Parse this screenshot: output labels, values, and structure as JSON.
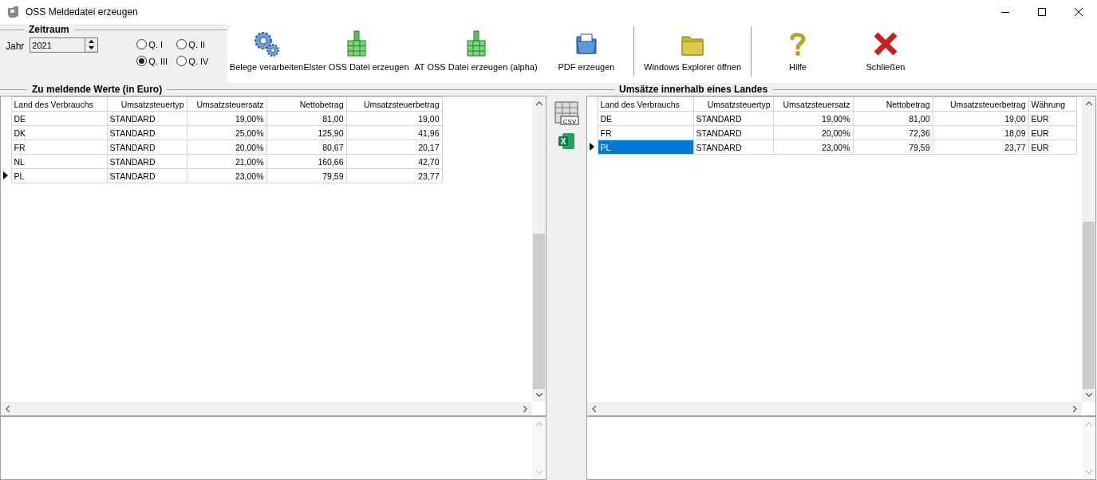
{
  "window": {
    "title": "OSS Meldedatei erzeugen"
  },
  "period": {
    "legend": "Zeitraum",
    "year_label": "Jahr",
    "year": "2021",
    "quarters": [
      {
        "label": "Q. I",
        "selected": false
      },
      {
        "label": "Q. II",
        "selected": false
      },
      {
        "label": "Q. III",
        "selected": true
      },
      {
        "label": "Q. IV",
        "selected": false
      }
    ]
  },
  "toolbar": [
    {
      "kind": "gears",
      "label": "Belege verarbeiten"
    },
    {
      "kind": "package",
      "label": "Elster OSS Datei erzeugen"
    },
    {
      "kind": "package",
      "label": "AT OSS Datei erzeugen (alpha)"
    },
    {
      "kind": "pdf",
      "label": "PDF erzeugen"
    },
    {
      "kind": "separator"
    },
    {
      "kind": "folder",
      "label": "Windows Explorer öffnen"
    },
    {
      "kind": "separator"
    },
    {
      "kind": "help",
      "label": "Hilfe"
    },
    {
      "kind": "close",
      "label": "Schließen"
    }
  ],
  "left_table": {
    "title": "Zu meldende Werte (in Euro)",
    "focused": false,
    "columns": [
      "Land des Verbrauchs",
      "Umsatzsteuertyp",
      "Umsatzsteuersatz",
      "Nettobetrag",
      "Umsatzsteuerbetrag"
    ],
    "rows": [
      {
        "cells": [
          "DE",
          "STANDARD",
          "19,00%",
          "81,00",
          "19,00"
        ],
        "current": false
      },
      {
        "cells": [
          "DK",
          "STANDARD",
          "25,00%",
          "125,90",
          "41,96"
        ],
        "current": false
      },
      {
        "cells": [
          "FR",
          "STANDARD",
          "20,00%",
          "80,67",
          "20,17"
        ],
        "current": false
      },
      {
        "cells": [
          "NL",
          "STANDARD",
          "21,00%",
          "160,66",
          "42,70"
        ],
        "current": false
      },
      {
        "cells": [
          "PL",
          "STANDARD",
          "23,00%",
          "79,59",
          "23,77"
        ],
        "current": true
      }
    ]
  },
  "export": {
    "csv_label": "CSV",
    "excel_label": "X"
  },
  "right_table": {
    "title": "Umsätze innerhalb eines Landes",
    "focused": true,
    "columns": [
      "Land des Verbrauchs",
      "Umsatzsteuertyp",
      "Umsatzsteuersatz",
      "Nettobetrag",
      "Umsatzsteuerbetrag",
      "Währung"
    ],
    "rows": [
      {
        "cells": [
          "DE",
          "STANDARD",
          "19,00%",
          "81,00",
          "19,00",
          "EUR"
        ],
        "current": false
      },
      {
        "cells": [
          "FR",
          "STANDARD",
          "20,00%",
          "72,36",
          "18,09",
          "EUR"
        ],
        "current": false
      },
      {
        "cells": [
          "PL",
          "STANDARD",
          "23,00%",
          "79,59",
          "23,77",
          "EUR"
        ],
        "current": true
      }
    ]
  }
}
